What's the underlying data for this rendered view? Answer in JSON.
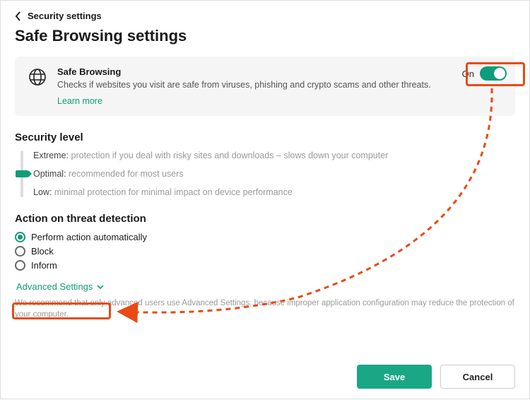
{
  "breadcrumb": "Security settings",
  "page_title": "Safe Browsing settings",
  "card": {
    "title": "Safe Browsing",
    "desc": "Checks if websites you visit are safe from viruses, phishing and crypto scams and other threats.",
    "learn_more": "Learn more",
    "toggle_state": "On"
  },
  "security_level": {
    "heading": "Security level",
    "selected_index": 1,
    "levels": [
      {
        "name": "Extreme:",
        "desc": "protection if you deal with risky sites and downloads – slows down your computer"
      },
      {
        "name": "Optimal:",
        "desc": "recommended for most users"
      },
      {
        "name": "Low:",
        "desc": "minimal protection for minimal impact on device performance"
      }
    ]
  },
  "threat_action": {
    "heading": "Action on threat detection",
    "options": [
      "Perform action automatically",
      "Block",
      "Inform"
    ],
    "selected_index": 0
  },
  "advanced_label": "Advanced Settings",
  "advanced_note": "We recommend that only advanced users use Advanced Settings, because improper application configuration may reduce the protection of your computer.",
  "buttons": {
    "save": "Save",
    "cancel": "Cancel"
  }
}
